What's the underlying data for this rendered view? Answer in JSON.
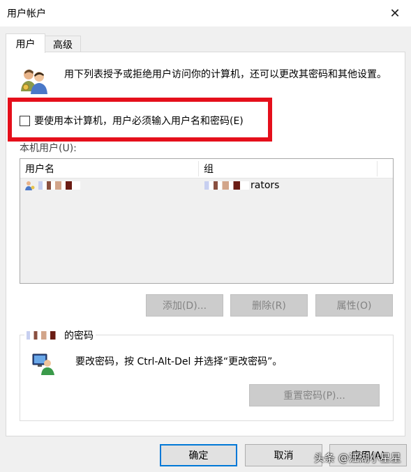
{
  "window": {
    "title": "用户帐户",
    "close_glyph": "✕"
  },
  "tabs": [
    {
      "label": "用户",
      "active": true
    },
    {
      "label": "高级",
      "active": false
    }
  ],
  "users_tab": {
    "description": "用下列表授予或拒绝用户访问你的计算机，还可以更改其密码和其他设置。",
    "require_login_checkbox": {
      "label": "要使用本计算机，用户必须输入用户名和密码(E)",
      "checked": false
    },
    "local_users_label": "本机用户(U):",
    "table": {
      "columns": [
        "用户名",
        "组"
      ],
      "rows": [
        {
          "username": "",
          "group": "rators"
        }
      ]
    },
    "buttons": {
      "add": "添加(D)...",
      "remove": "删除(R)",
      "properties": "属性(O)"
    },
    "password_group": {
      "legend": "的密码",
      "instruction": "要改密码，按 Ctrl-Alt-Del 并选择“更改密码”。",
      "reset_button": "重置密码(P)..."
    }
  },
  "dialog_buttons": {
    "ok": "确定",
    "cancel": "取消",
    "apply": "应用(A)"
  },
  "watermark": "头条 @江湖小星星",
  "colors": {
    "highlight": "#e50f1b",
    "primary_border": "#0078d7",
    "disabled_bg": "#cccccc"
  }
}
